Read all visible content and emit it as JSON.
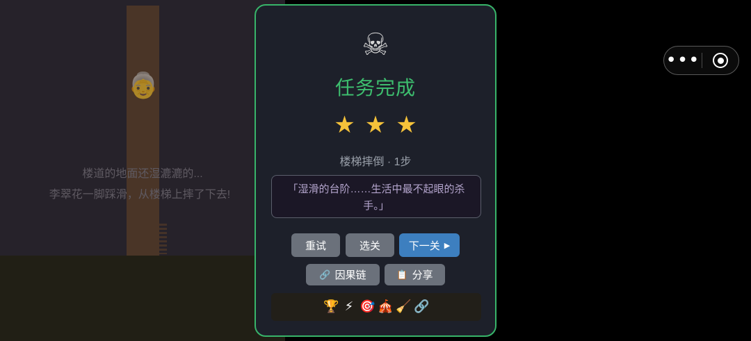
{
  "scene": {
    "character_icon": "person-icon",
    "line1": "楼道的地面还湿漉漉的...",
    "line2": "李翠花一脚踩滑，从楼梯上摔了下去!"
  },
  "capsule": {
    "more_icon": "more-dots-icon",
    "close_icon": "target-circle-icon"
  },
  "result": {
    "icon_glyph": "☠",
    "icon_name": "skull-crossbones-icon",
    "title": "任务完成",
    "stars": 3,
    "stars_max": 3,
    "star_glyph": "★",
    "level_info": "楼梯摔倒 · 1步",
    "quote": "「湿滑的台阶……生活中最不起眼的杀手。」",
    "buttons": {
      "retry": "重试",
      "select_level": "选关",
      "next": "下一关",
      "next_icon": "▶",
      "causal_chain": "因果链",
      "causal_chain_icon": "🔗",
      "share": "分享",
      "share_icon": "📋"
    },
    "achievements": [
      {
        "glyph": "🏆",
        "name": "trophy-icon"
      },
      {
        "glyph": "⚡",
        "name": "lightning-icon"
      },
      {
        "glyph": "🎯",
        "name": "target-icon"
      },
      {
        "glyph": "🎪",
        "name": "circus-tent-icon"
      },
      {
        "glyph": "🧹",
        "name": "broom-icon"
      },
      {
        "glyph": "🔗",
        "name": "link-icon"
      }
    ]
  },
  "colors": {
    "accent_green": "#3dbd6e",
    "star_yellow": "#f5c23a",
    "button_blue": "#3d7fbf",
    "button_gray": "#6b717b"
  }
}
